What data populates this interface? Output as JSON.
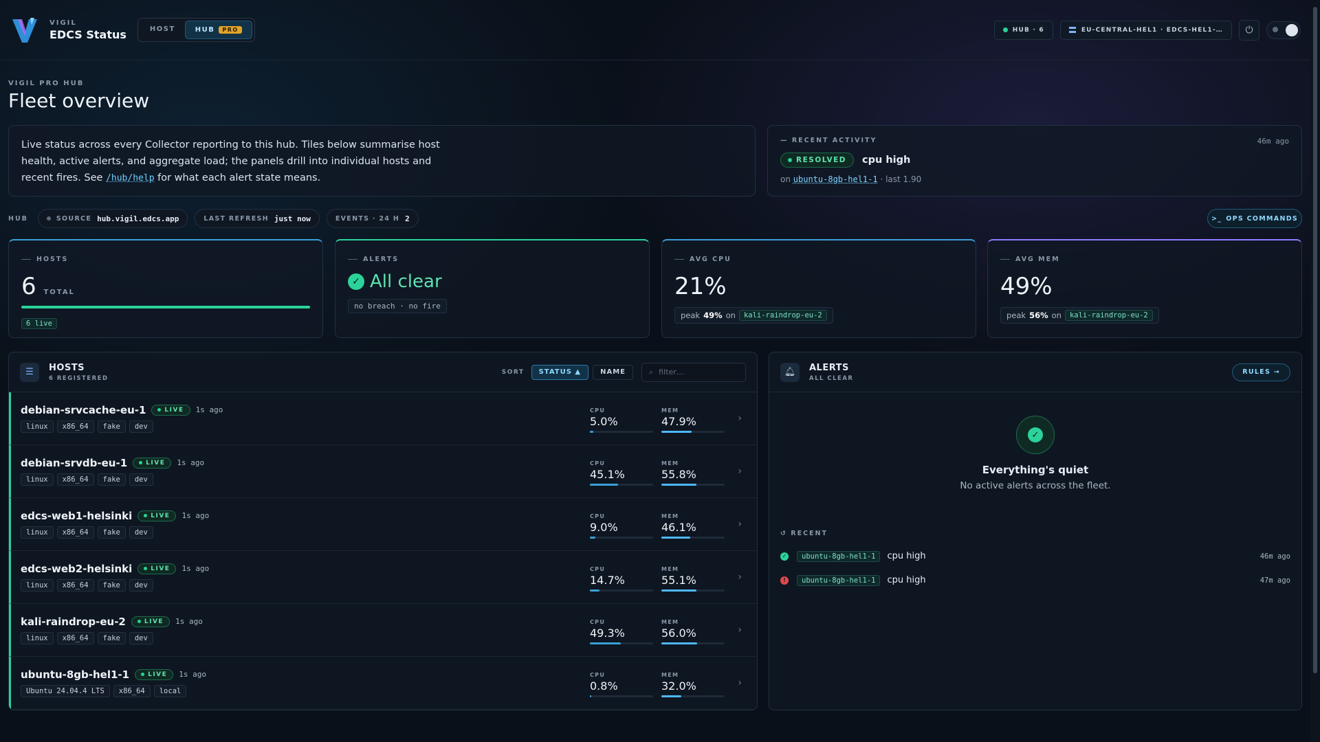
{
  "colors": {
    "accent": "#3aa0d8",
    "live": "#2bd29a",
    "error": "#e5484d",
    "pro": "#e0a326"
  },
  "header": {
    "brand_small": "VIGIL",
    "brand_title": "EDCS Status",
    "mode_host": "HOST",
    "mode_hub": "HUB",
    "pro_badge": "PRO",
    "hub_pill": "HUB · 6",
    "region_pill": "EU-CENTRAL-HEL1 · EDCS-HEL1-…",
    "power_icon": "power-icon",
    "theme_icon": "theme-toggle-icon"
  },
  "page": {
    "eyebrow": "VIGIL PRO HUB",
    "title": "Fleet overview",
    "intro_text": "Live status across every Collector reporting to this hub. Tiles below summarise host health, active alerts, and aggregate load; the panels drill into individual hosts and recent fires. See ",
    "intro_link": "/hub/help",
    "intro_tail": " for what each alert state means."
  },
  "recent_activity": {
    "label": "RECENT ACTIVITY",
    "time": "46m ago",
    "status": "RESOLVED",
    "title": "cpu high",
    "on": "on",
    "host": "ubuntu-8gb-hel1-1",
    "detail": "· last 1.90"
  },
  "strip": {
    "hub_label": "HUB",
    "source_label": "SOURCE",
    "source_value": "hub.vigil.edcs.app",
    "refresh_label": "LAST REFRESH",
    "refresh_value": "just now",
    "events_label": "EVENTS · 24 H",
    "events_value": "2",
    "ops_button": "OPS COMMANDS"
  },
  "kpis": {
    "hosts": {
      "label": "HOSTS",
      "value": "6",
      "unit": "TOTAL",
      "badge": "6 live",
      "fill": 1.0
    },
    "alerts": {
      "label": "ALERTS",
      "value": "All clear",
      "sub": "no breach · no fire"
    },
    "cpu": {
      "label": "AVG CPU",
      "value": "21%",
      "peak_label": "peak",
      "peak": "49%",
      "on": "on",
      "host": "kali-raindrop-eu-2"
    },
    "mem": {
      "label": "AVG MEM",
      "value": "49%",
      "peak_label": "peak",
      "peak": "56%",
      "on": "on",
      "host": "kali-raindrop-eu-2"
    }
  },
  "hosts_panel": {
    "title": "HOSTS",
    "subtitle": "6 REGISTERED",
    "sort_label": "SORT",
    "sort_status": "STATUS ▲",
    "sort_name": "NAME",
    "filter_placeholder": "filter…",
    "cpu_label": "CPU",
    "mem_label": "MEM",
    "rows": [
      {
        "name": "debian-srvcache-eu-1",
        "status": "LIVE",
        "ago": "1s ago",
        "tags": [
          "linux",
          "x86_64",
          "fake",
          "dev"
        ],
        "cpu": "5.0%",
        "cpu_v": 5.0,
        "mem": "47.9%",
        "mem_v": 47.9
      },
      {
        "name": "debian-srvdb-eu-1",
        "status": "LIVE",
        "ago": "1s ago",
        "tags": [
          "linux",
          "x86_64",
          "fake",
          "dev"
        ],
        "cpu": "45.1%",
        "cpu_v": 45.1,
        "mem": "55.8%",
        "mem_v": 55.8
      },
      {
        "name": "edcs-web1-helsinki",
        "status": "LIVE",
        "ago": "1s ago",
        "tags": [
          "linux",
          "x86_64",
          "fake",
          "dev"
        ],
        "cpu": "9.0%",
        "cpu_v": 9.0,
        "mem": "46.1%",
        "mem_v": 46.1
      },
      {
        "name": "edcs-web2-helsinki",
        "status": "LIVE",
        "ago": "1s ago",
        "tags": [
          "linux",
          "x86_64",
          "fake",
          "dev"
        ],
        "cpu": "14.7%",
        "cpu_v": 14.7,
        "mem": "55.1%",
        "mem_v": 55.1
      },
      {
        "name": "kali-raindrop-eu-2",
        "status": "LIVE",
        "ago": "1s ago",
        "tags": [
          "linux",
          "x86_64",
          "fake",
          "dev"
        ],
        "cpu": "49.3%",
        "cpu_v": 49.3,
        "mem": "56.0%",
        "mem_v": 56.0
      },
      {
        "name": "ubuntu-8gb-hel1-1",
        "status": "LIVE",
        "ago": "1s ago",
        "tags": [
          "Ubuntu 24.04.4 LTS",
          "x86_64",
          "local"
        ],
        "cpu": "0.8%",
        "cpu_v": 0.8,
        "mem": "32.0%",
        "mem_v": 32.0
      }
    ]
  },
  "alerts_panel": {
    "title": "ALERTS",
    "subtitle": "ALL CLEAR",
    "rules_button": "RULES →",
    "quiet_title": "Everything's quiet",
    "quiet_sub": "No active alerts across the fleet.",
    "recent_label": "RECENT",
    "recent": [
      {
        "state": "resolved",
        "host": "ubuntu-8gb-hel1-1",
        "text": "cpu high",
        "time": "46m ago"
      },
      {
        "state": "firing",
        "host": "ubuntu-8gb-hel1-1",
        "text": "cpu high",
        "time": "47m ago"
      }
    ]
  }
}
